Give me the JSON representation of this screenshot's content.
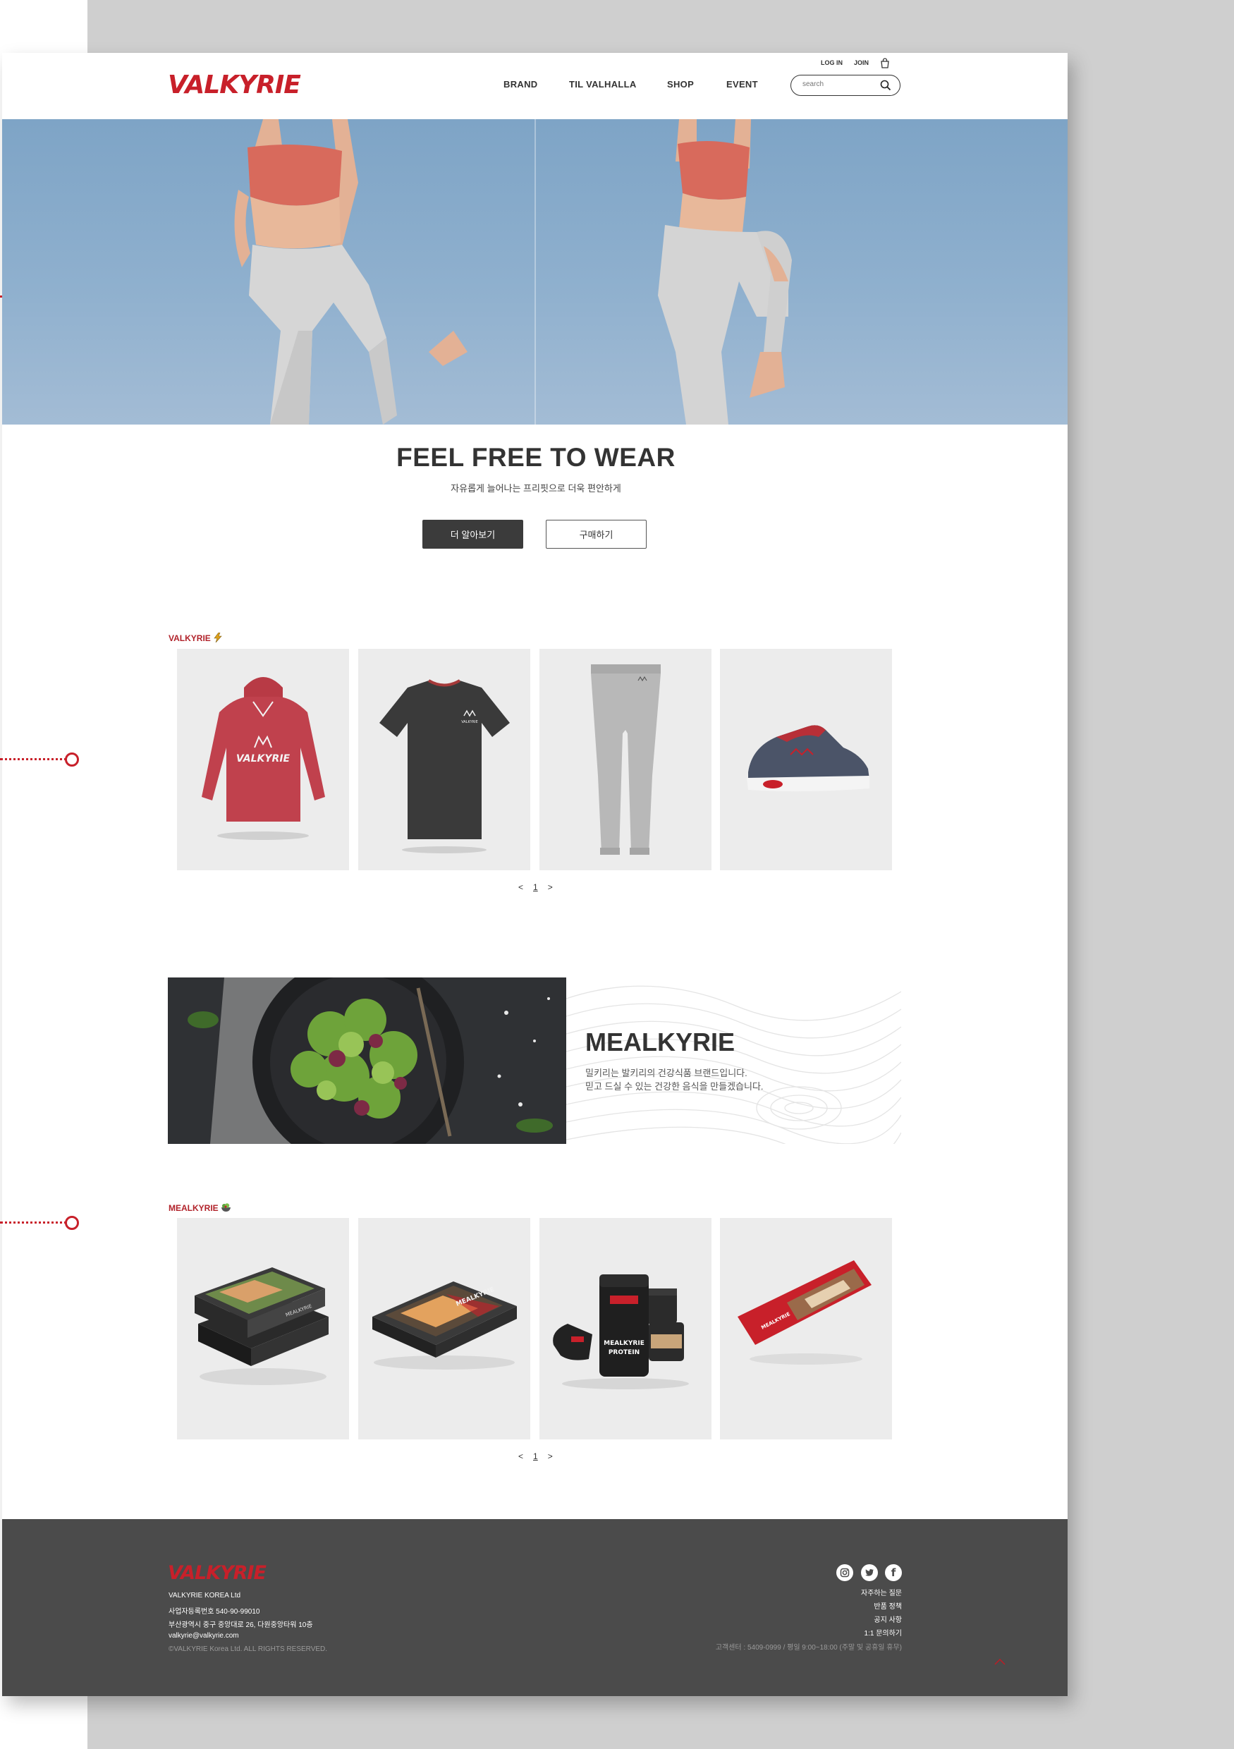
{
  "brand": {
    "logo": "VALKYRIE",
    "accent": "#c8202a"
  },
  "header": {
    "util": {
      "login": "LOG IN",
      "join": "JOIN"
    },
    "nav": [
      "BRAND",
      "TIL VALHALLA",
      "SHOP",
      "EVENT"
    ],
    "search": {
      "placeholder": "search"
    }
  },
  "hero": {
    "title": "FEEL FREE TO WEAR",
    "subtitle": "자유롭게 늘어나는 프리핏으로 더욱 편안하게",
    "primary_button": "더 알아보기",
    "secondary_button": "구매하기"
  },
  "valkyrie_section": {
    "label": "VALKYRIE",
    "label_icon": "lightning-icon",
    "products": [
      "red-hoodie",
      "black-tshirt",
      "gray-joggers",
      "navy-sneaker"
    ],
    "pager": {
      "prev": "<",
      "page": "1",
      "next": ">"
    }
  },
  "meal_banner": {
    "title": "MEALKYRIE",
    "desc_line1": "밀키리는 발키리의 건강식품 브랜드입니다.",
    "desc_line2": "믿고 드실 수 있는 건강한 음식을 만들겠습니다."
  },
  "mealkyrie_section": {
    "label": "MEALKYRIE",
    "label_icon": "salad-bowl-icon",
    "products": [
      "meal-box-stack",
      "meal-box-single",
      "protein-jars",
      "energy-bar"
    ],
    "pager": {
      "prev": "<",
      "page": "1",
      "next": ">"
    }
  },
  "footer": {
    "logo": "VALKYRIE",
    "company": "VALKYRIE KOREA Ltd",
    "biz_no": "사업자등록번호 540-90-99010",
    "address": "부산광역시 중구 중앙대로 26, 다원중앙타워 10층",
    "email": "valkyrie@valkyrie.com",
    "copyright": "©VALKYRIE Korea Ltd. ALL RIGHTS RESERVED.",
    "links": [
      "자주하는 질문",
      "반품 정책",
      "공지 사항",
      "1:1 문의하기"
    ],
    "cs": "고객센터 : 5409-0999 / 평일 9:00~18:00 (주말 및 공휴일 휴무)",
    "social": [
      "instagram-icon",
      "twitter-icon",
      "facebook-icon"
    ]
  }
}
